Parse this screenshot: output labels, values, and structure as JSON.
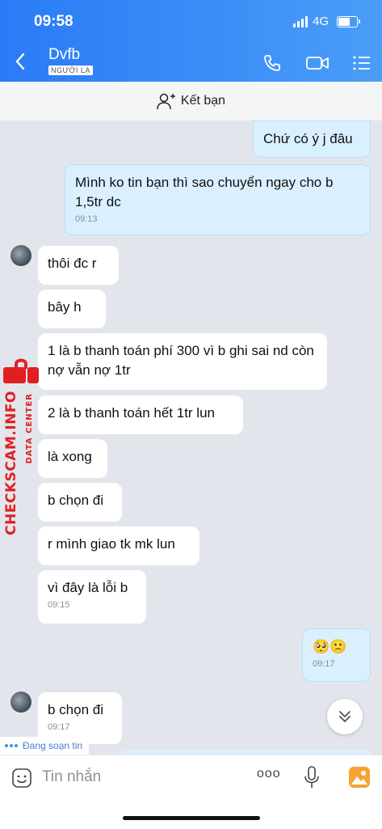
{
  "status": {
    "time": "09:58",
    "network": "4G"
  },
  "header": {
    "contact_name": "Dvfb",
    "badge": "NGƯỜI LẠ"
  },
  "add_friend": {
    "label": "Kết bạn"
  },
  "messages": [
    {
      "side": "out",
      "text": "Chứ có ý j đâu",
      "time": ""
    },
    {
      "side": "out",
      "text": "Mình ko tin bạn thì sao chuyển ngay cho b 1,5tr dc",
      "time": "09:13"
    },
    {
      "side": "in",
      "text": "thôi đc r",
      "time": ""
    },
    {
      "side": "in",
      "text": "bây h",
      "time": ""
    },
    {
      "side": "in",
      "text": "1 là b thanh toán phí 300 vì b ghi sai nd còn nợ vẫn nợ 1tr",
      "time": ""
    },
    {
      "side": "in",
      "text": "2 là b thanh toán hết 1tr lun",
      "time": ""
    },
    {
      "side": "in",
      "text": "là xong",
      "time": ""
    },
    {
      "side": "in",
      "text": "b chọn đi",
      "time": ""
    },
    {
      "side": "in",
      "text": "r mình giao tk mk lun",
      "time": ""
    },
    {
      "side": "in",
      "text": "vì đây là lỗi b",
      "time": "09:15"
    },
    {
      "side": "out",
      "text": "🥺🙁",
      "time": "09:17"
    },
    {
      "side": "in",
      "text": "b chọn đi",
      "time": "09:17"
    }
  ],
  "watermark": {
    "main": "CHECKSCAM.INFO",
    "sub": "DATA CENTER"
  },
  "typing_indicator": "Đang soạn tin",
  "composer": {
    "placeholder": "Tin nhắn",
    "more": "ooo"
  },
  "colors": {
    "header": "#2a7bf6",
    "outgoing": "#daf0ff",
    "incoming": "#ffffff",
    "watermark": "#e02020"
  }
}
